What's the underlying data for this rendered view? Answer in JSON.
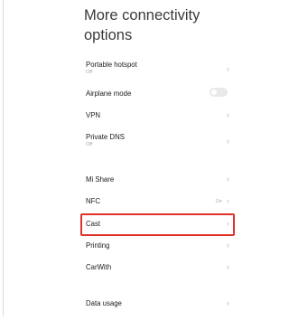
{
  "header": {
    "title": "More connectivity options"
  },
  "settings": {
    "portable_hotspot": {
      "label": "Portable hotspot",
      "status": "Off"
    },
    "airplane_mode": {
      "label": "Airplane mode",
      "enabled": false
    },
    "vpn": {
      "label": "VPN"
    },
    "private_dns": {
      "label": "Private DNS",
      "status": "Off"
    },
    "mi_share": {
      "label": "Mi Share"
    },
    "nfc": {
      "label": "NFC",
      "value": "On"
    },
    "cast": {
      "label": "Cast",
      "highlighted": true
    },
    "printing": {
      "label": "Printing"
    },
    "carwith": {
      "label": "CarWith"
    },
    "data_usage": {
      "label": "Data usage"
    }
  },
  "icons": {
    "chevron": "›",
    "chevron_name": "chevron-right-icon"
  },
  "colors": {
    "highlight_border": "#e0332a",
    "toggle_off": "#e9e9e9"
  }
}
